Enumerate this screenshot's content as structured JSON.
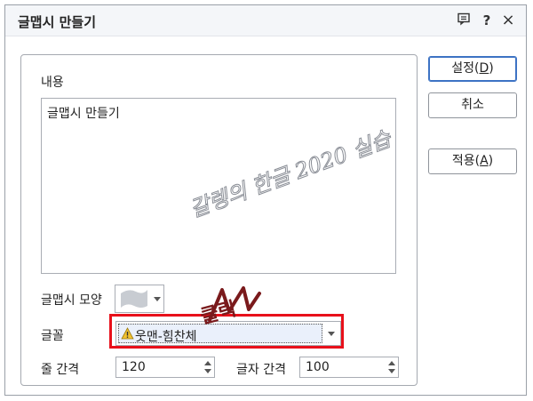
{
  "window": {
    "title": "글맵시 만들기",
    "help_label": "?",
    "close_label": "×"
  },
  "content": {
    "label": "내용",
    "value": "글맵시 만들기"
  },
  "shape": {
    "label": "글맵시 모양"
  },
  "font": {
    "label": "글꼴",
    "value": "웃맨-힘찬체"
  },
  "line_spacing": {
    "label": "줄 간격",
    "value": "120"
  },
  "char_spacing": {
    "label": "글자 간격",
    "value": "100"
  },
  "buttons": {
    "ok_prefix": "설정(",
    "ok_key": "D",
    "ok_suffix": ")",
    "cancel": "취소",
    "apply_prefix": "적용(",
    "apply_key": "A",
    "apply_suffix": ")"
  },
  "annotations": {
    "watermark": "갈렝의 한글 2020 실습",
    "click_label": "클릭"
  },
  "colors": {
    "highlight": "#e8101a",
    "primary_border": "#3d73c4",
    "annotation": "#7a1a1c"
  }
}
